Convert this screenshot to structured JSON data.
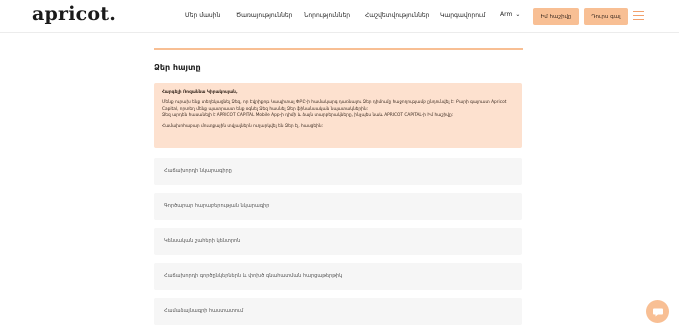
{
  "brand": {
    "logo": "apricot."
  },
  "nav": {
    "items": [
      "Մեր մասին",
      "Ծառայություններ",
      "Նորություններ",
      "Հաշվետվություններ",
      "Կարգավորում"
    ],
    "language": "Arm"
  },
  "actions": {
    "open_account": "Իմ հաշիվը",
    "contact": "Դուրս գալ"
  },
  "page": {
    "title": "Ձեր հայտը",
    "notice": {
      "heading": "Հարգելի Ռոզաննա Կիրակոսյան,",
      "paragraph1": "Մենք ուրախ ենք տեղեկացնել Ձեզ, որ Էվրիքոթ Կապիտալ ՓԲԸ-ի համակարգ դառնալու Ձեր դիմումը հաջողությամբ ընդունվել է: Բարի գալուստ Apricot Capital, որտեղ մենք պատրաստ ենք օգնել Ձեզ հասնել Ձեր ֆինանսական նպատակներին:",
      "paragraph2": "Ձեզ արդեն հասանելի է APRICOT CAPITAL Mobile App-ի դիմի և ձայն տարբերակները, ինչպես նաև APRICOT CAPITAL-ի Իմ հաշիվը:",
      "paragraph3": "Համախոհաբար մուտքային տվյալներն ուղարկվել են Ձեր էլ. հասցեին:"
    },
    "sections": [
      "Հաճախորդի նկարագիրը",
      "Գործարար հարաբերության նկարագիր",
      "Կենսական շահերի կենտրոն",
      "Հաճախորդի գործընկերներն և փոխծ գնահատման հարցաթերթիկ",
      "Համաձայնագրի հաստատում"
    ]
  },
  "colors": {
    "accent": "#f8bf94",
    "notice_bg": "#fde1cf",
    "row_bg": "#f6f6f6"
  },
  "icons": {
    "chat": "chat-bubble-icon",
    "menu": "hamburger-menu-icon",
    "chevron": "chevron-down-icon"
  }
}
